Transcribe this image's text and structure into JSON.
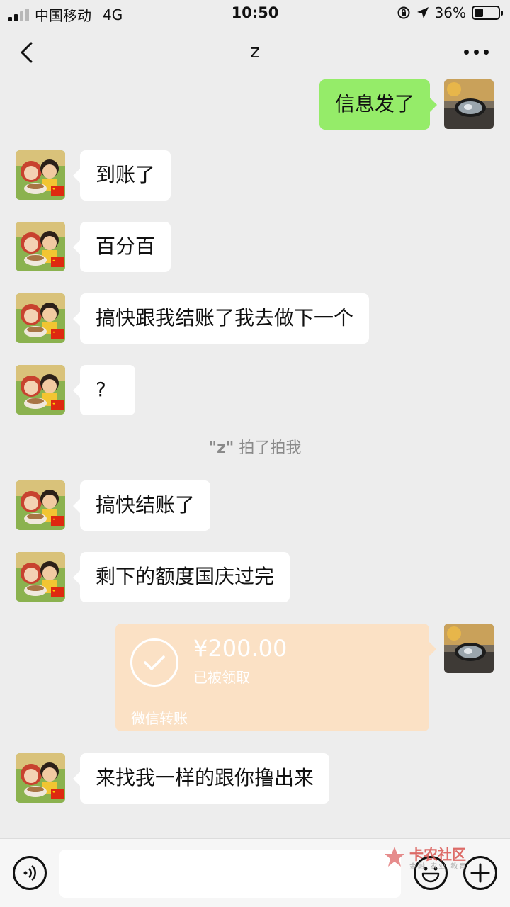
{
  "status_bar": {
    "carrier": "中国移动",
    "network": "4G",
    "time": "10:50",
    "battery": "36%",
    "battery_level": 0.36
  },
  "header": {
    "title": "z"
  },
  "messages": [
    {
      "side": "out",
      "text": "信息发了"
    },
    {
      "side": "in",
      "text": "到账了"
    },
    {
      "side": "in",
      "text": "百分百"
    },
    {
      "side": "in",
      "text": "搞快跟我结账了我去做下一个"
    },
    {
      "side": "in",
      "text": "?"
    },
    {
      "side": "in",
      "text": "搞快结账了"
    },
    {
      "side": "in",
      "text": "剩下的额度国庆过完"
    },
    {
      "side": "in",
      "text": "来找我一样的跟你撸出来"
    }
  ],
  "system_note": {
    "name": "\"z\"",
    "action": "拍了拍我"
  },
  "transfer": {
    "amount": "¥200.00",
    "status": "已被领取",
    "label": "微信转账"
  },
  "watermark": {
    "title": "卡农社区",
    "subtitle": "金融 农业 教育"
  },
  "colors": {
    "background": "#ededed",
    "outgoing_bubble": "#95ec69",
    "incoming_bubble": "#ffffff",
    "transfer_card": "#fbe1c5"
  }
}
